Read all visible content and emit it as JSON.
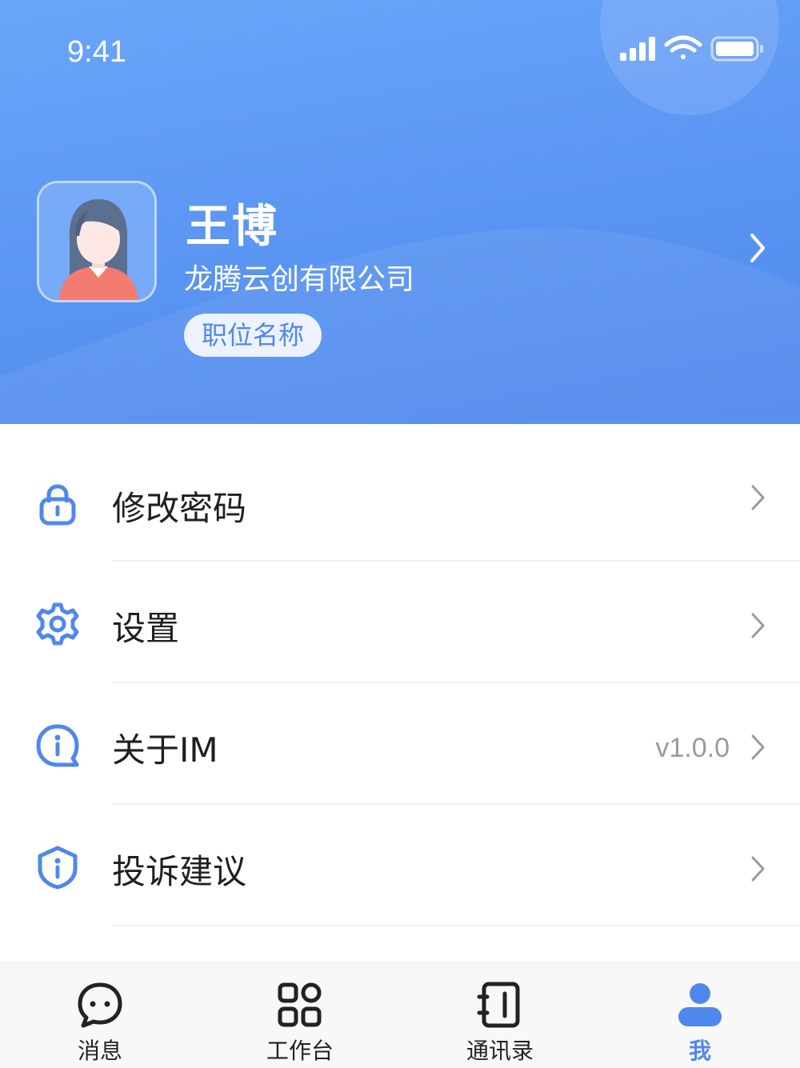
{
  "colors": {
    "accent": "#4f88ec",
    "header_gradient_start": "#6aa6fb",
    "header_gradient_end": "#4f88ec",
    "text_primary": "#1f1f1f",
    "text_secondary": "#9a9a9a",
    "divider": "#f0f0f0"
  },
  "status_bar": {
    "time": "9:41",
    "icons": [
      "signal-icon",
      "wifi-icon",
      "battery-icon"
    ]
  },
  "profile": {
    "name": "王博",
    "company": "龙腾云创有限公司",
    "position": "职位名称",
    "avatar_icon": "female-avatar-icon",
    "chevron_icon": "chevron-right-icon"
  },
  "menu": {
    "items": [
      {
        "icon": "lock-icon",
        "label": "修改密码",
        "value": ""
      },
      {
        "icon": "gear-icon",
        "label": "设置",
        "value": ""
      },
      {
        "icon": "info-bubble-icon",
        "label": "关于IM",
        "value": "v1.0.0"
      },
      {
        "icon": "shield-info-icon",
        "label": "投诉建议",
        "value": ""
      }
    ]
  },
  "tabbar": {
    "tabs": [
      {
        "icon": "chat-bubble-icon",
        "label": "消息",
        "active": false
      },
      {
        "icon": "grid-apps-icon",
        "label": "工作台",
        "active": false
      },
      {
        "icon": "contacts-book-icon",
        "label": "通讯录",
        "active": false
      },
      {
        "icon": "person-icon",
        "label": "我",
        "active": true
      }
    ]
  }
}
